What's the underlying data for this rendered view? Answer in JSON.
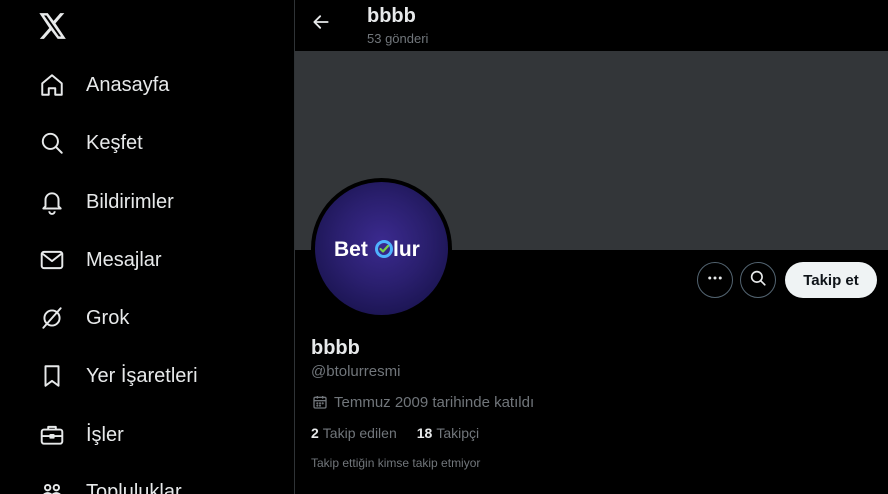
{
  "sidebar": {
    "logo_icon": "x-logo-icon",
    "items": [
      {
        "label": "Anasayfa",
        "icon": "home-icon"
      },
      {
        "label": "Keşfet",
        "icon": "search-icon"
      },
      {
        "label": "Bildirimler",
        "icon": "bell-icon"
      },
      {
        "label": "Mesajlar",
        "icon": "mail-icon"
      },
      {
        "label": "Grok",
        "icon": "grok-icon"
      },
      {
        "label": "Yer İşaretleri",
        "icon": "bookmark-icon"
      },
      {
        "label": "İşler",
        "icon": "briefcase-icon"
      },
      {
        "label": "Topluluklar",
        "icon": "communities-icon"
      }
    ]
  },
  "header": {
    "title": "bbbb",
    "post_count": "53 gönderi"
  },
  "profile": {
    "avatar_text": "BetOlur",
    "name": "bbbb",
    "handle": "@btolurresmi",
    "joined": "Temmuz 2009 tarihinde katıldı",
    "following_count": "2",
    "following_label": "Takip edilen",
    "followers_count": "18",
    "followers_label": "Takipçi",
    "followed_by_note": "Takip ettiğin kimse takip etmiyor",
    "follow_button": "Takip et"
  },
  "colors": {
    "background": "#000000",
    "banner": "#333639",
    "text_primary": "#e7e9ea",
    "text_secondary": "#71767b",
    "border": "#2f3336",
    "avatar_bg": "#2a1f6e"
  }
}
